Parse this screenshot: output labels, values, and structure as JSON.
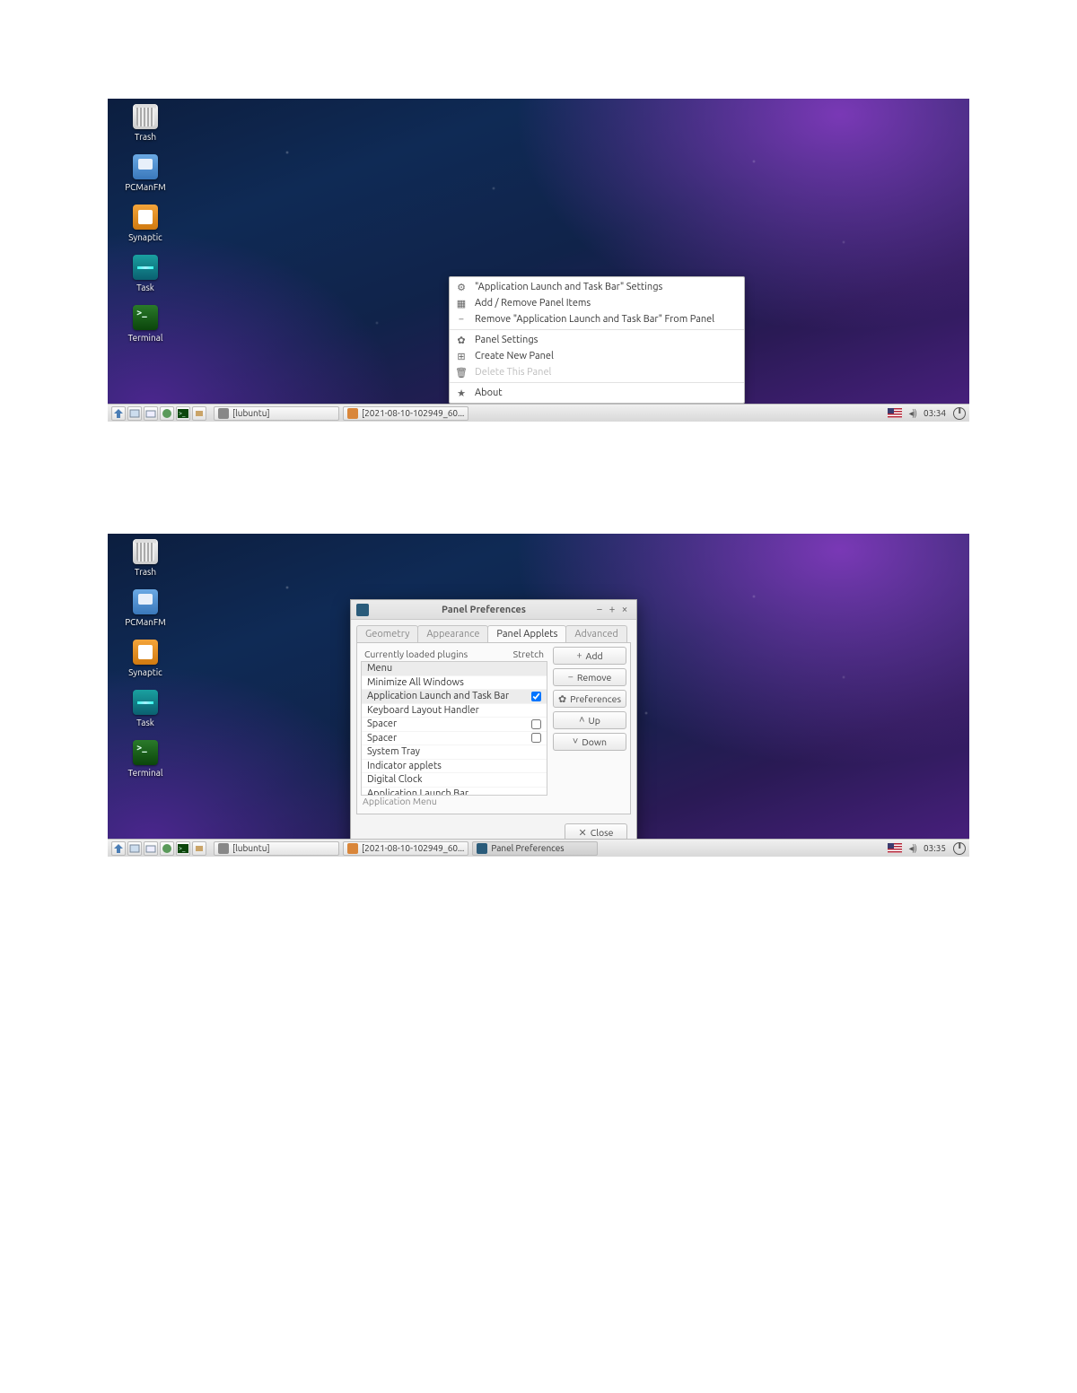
{
  "desktop_icons": [
    {
      "label": "Trash",
      "cls": "ic-trash",
      "name": "desktop-icon-trash"
    },
    {
      "label": "PCManFM",
      "cls": "ic-pcman",
      "name": "desktop-icon-pcmanfm"
    },
    {
      "label": "Synaptic",
      "cls": "ic-synaptic",
      "name": "desktop-icon-synaptic"
    },
    {
      "label": "Task",
      "cls": "ic-task",
      "name": "desktop-icon-task"
    },
    {
      "label": "Terminal",
      "cls": "ic-term",
      "name": "desktop-icon-terminal"
    }
  ],
  "panel": {
    "task1": {
      "label": "[lubuntu]",
      "icon_bg": "#888",
      "name": "taskbar-item-lubuntu"
    },
    "task2": {
      "label": "[2021-08-10-102949_60...",
      "icon_bg": "#d9863a",
      "name": "taskbar-item-screenshot"
    },
    "task3": {
      "label": "Panel Preferences",
      "icon_bg": "#2a5b7a",
      "name": "taskbar-item-panel-preferences"
    },
    "clock1": "03:34",
    "clock2": "03:35"
  },
  "context_menu": {
    "items": [
      {
        "icon": "⚙",
        "label": "\"Application Launch and Task Bar\" Settings",
        "name": "menu-item-applet-settings"
      },
      {
        "icon": "▦",
        "label": "Add / Remove Panel Items",
        "name": "menu-item-add-remove-items"
      },
      {
        "icon": "−",
        "label": "Remove \"Application Launch and Task Bar\" From Panel",
        "name": "menu-item-remove-applet"
      },
      {
        "sep": true
      },
      {
        "icon": "✿",
        "label": "Panel Settings",
        "name": "menu-item-panel-settings"
      },
      {
        "icon": "⊞",
        "label": "Create New Panel",
        "name": "menu-item-create-panel"
      },
      {
        "icon": "🗑",
        "label": "Delete This Panel",
        "disabled": true,
        "name": "menu-item-delete-panel"
      },
      {
        "sep": true
      },
      {
        "icon": "★",
        "label": "About",
        "name": "menu-item-about"
      }
    ]
  },
  "dialog": {
    "title": "Panel Preferences",
    "tabs": [
      "Geometry",
      "Appearance",
      "Panel Applets",
      "Advanced"
    ],
    "active_tab": 2,
    "header_col1": "Currently loaded plugins",
    "header_col2": "Stretch",
    "plugins": [
      {
        "label": "Menu",
        "checkbox": null,
        "selected": true
      },
      {
        "label": "Minimize All Windows",
        "checkbox": null
      },
      {
        "label": "Application Launch and Task Bar",
        "checkbox": true,
        "selected": true
      },
      {
        "label": "Keyboard Layout Handler",
        "checkbox": null
      },
      {
        "label": "Spacer",
        "checkbox": false
      },
      {
        "label": "Spacer",
        "checkbox": false
      },
      {
        "label": "System Tray",
        "checkbox": null
      },
      {
        "label": "Indicator applets",
        "checkbox": null
      },
      {
        "label": "Digital Clock",
        "checkbox": null
      },
      {
        "label": "Application Launch Bar",
        "checkbox": null
      }
    ],
    "below_list": "Application Menu",
    "buttons": {
      "add": "Add",
      "remove": "Remove",
      "prefs": "Preferences",
      "up": "Up",
      "down": "Down",
      "close": "Close"
    }
  }
}
